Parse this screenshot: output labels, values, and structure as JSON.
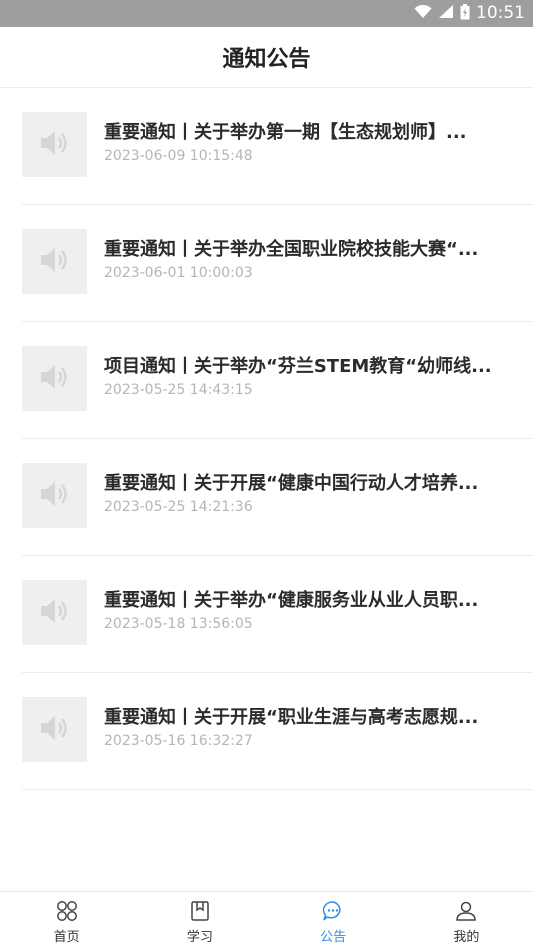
{
  "status_bar": {
    "time": "10:51",
    "icons": [
      "wifi-icon",
      "signal-icon",
      "battery-icon"
    ]
  },
  "header": {
    "title": "通知公告"
  },
  "notices": [
    {
      "title": "重要通知丨关于举办第一期【生态规划师】...",
      "time": "2023-06-09 10:15:48",
      "icon": "speaker-icon"
    },
    {
      "title": "重要通知丨关于举办全国职业院校技能大赛“...",
      "time": "2023-06-01 10:00:03",
      "icon": "speaker-icon"
    },
    {
      "title": "项目通知丨关于举办“芬兰STEM教育“幼师线...",
      "time": "2023-05-25 14:43:15",
      "icon": "speaker-icon"
    },
    {
      "title": "重要通知丨关于开展“健康中国行动人才培养...",
      "time": "2023-05-25 14:21:36",
      "icon": "speaker-icon"
    },
    {
      "title": "重要通知丨关于举办“健康服务业从业人员职...",
      "time": "2023-05-18 13:56:05",
      "icon": "speaker-icon"
    },
    {
      "title": "重要通知丨关于开展“职业生涯与高考志愿规...",
      "time": "2023-05-16 16:32:27",
      "icon": "speaker-icon"
    }
  ],
  "tabbar": {
    "tabs": [
      {
        "label": "首页",
        "icon": "home-grid-icon",
        "active": false
      },
      {
        "label": "学习",
        "icon": "book-icon",
        "active": false
      },
      {
        "label": "公告",
        "icon": "chat-bubble-icon",
        "active": true
      },
      {
        "label": "我的",
        "icon": "user-icon",
        "active": false
      }
    ]
  },
  "colors": {
    "status_bar_bg": "#9e9e9e",
    "accent": "#2d8cf0",
    "title_text": "#2b2b2b",
    "time_text": "#b5b5b5",
    "thumb_bg": "#efefef"
  }
}
